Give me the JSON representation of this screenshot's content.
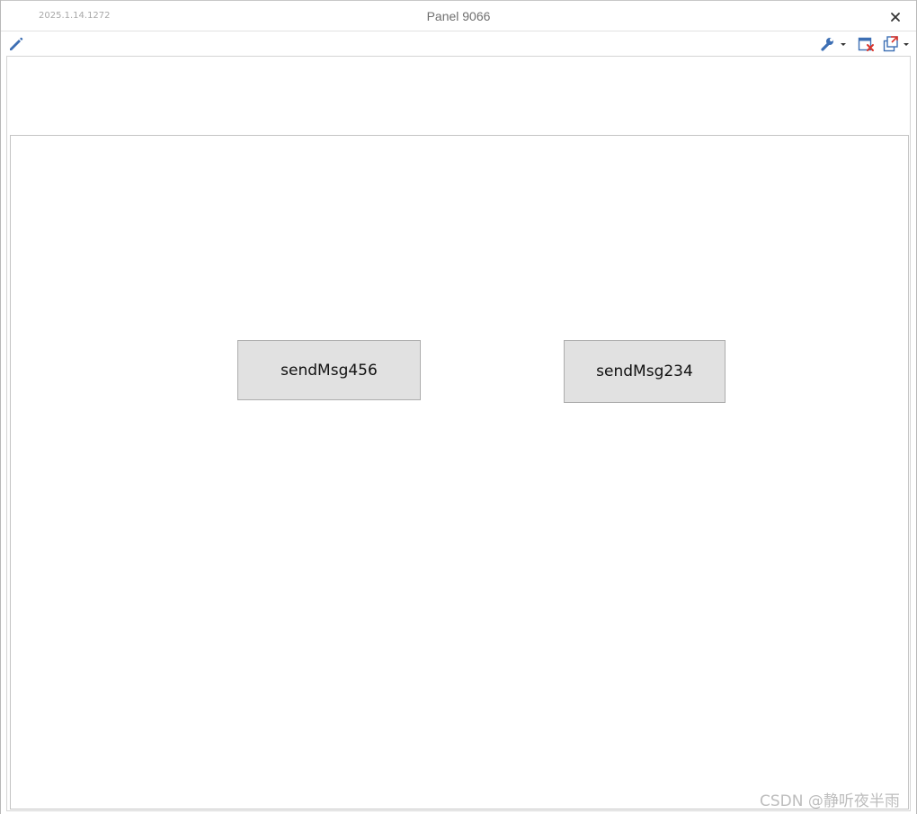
{
  "window": {
    "version": "2025.1.14.1272",
    "title": "Panel 9066"
  },
  "toolbar": {
    "icons": [
      "pencil-icon",
      "wrench-icon",
      "close-panel-icon",
      "export-icon"
    ]
  },
  "panel": {
    "buttons": [
      {
        "label": "sendMsg456"
      },
      {
        "label": "sendMsg234"
      }
    ]
  },
  "watermark": "CSDN @静听夜半雨",
  "colors": {
    "accent_blue": "#3d6fb4",
    "close_red": "#d9342b",
    "button_bg": "#e1e1e1"
  }
}
